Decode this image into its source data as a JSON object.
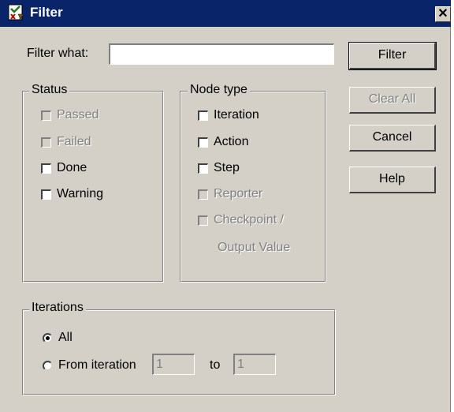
{
  "window": {
    "title": "Filter",
    "close_glyph": "✕"
  },
  "filter_what": {
    "label": "Filter what:",
    "value": ""
  },
  "buttons": {
    "filter": "Filter",
    "clear_all": "Clear All",
    "cancel": "Cancel",
    "help": "Help"
  },
  "status": {
    "title": "Status",
    "items": [
      "Passed",
      "Failed",
      "Done",
      "Warning"
    ]
  },
  "node_type": {
    "title": "Node type",
    "items": [
      "Iteration",
      "Action",
      "Step",
      "Reporter",
      "Checkpoint /",
      "Output Value"
    ]
  },
  "iterations": {
    "title": "Iterations",
    "all_label": "All",
    "from_label": "From iteration",
    "from_value": "1",
    "to_label": "to",
    "to_value": "1"
  },
  "colors": {
    "titlebar": "#0a246a",
    "face": "#d4d0c8",
    "disabled_text": "#808080"
  }
}
